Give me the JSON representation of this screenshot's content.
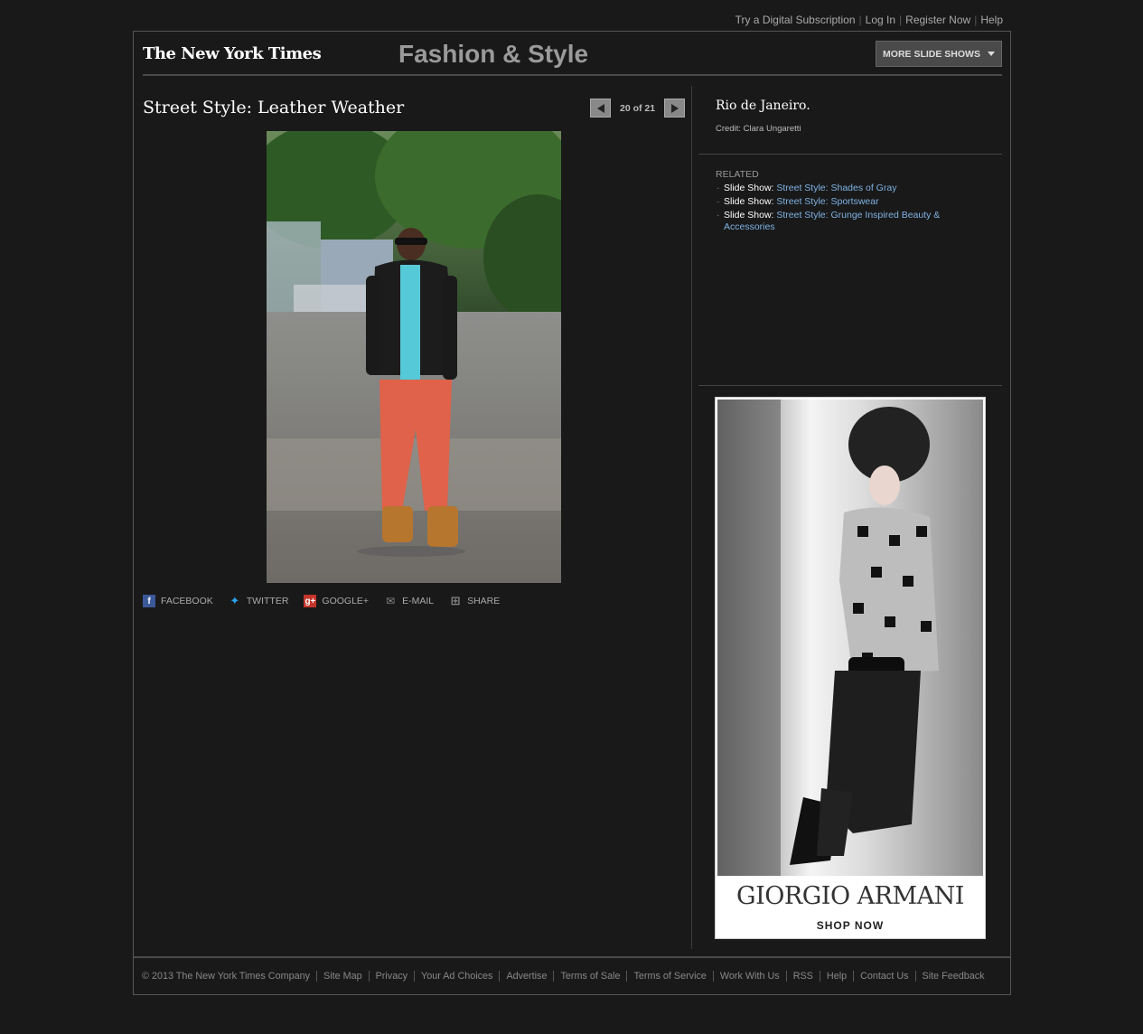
{
  "top_links": [
    "Try a Digital Subscription",
    "Log In",
    "Register Now",
    "Help"
  ],
  "masthead": {
    "logo": "The New York Times",
    "section": "Fashion & Style",
    "more_label": "MORE SLIDE SHOWS"
  },
  "slideshow": {
    "title": "Street Style: Leather Weather",
    "counter": "20 of 21"
  },
  "share": [
    {
      "label": "FACEBOOK",
      "icon": "facebook-icon"
    },
    {
      "label": "TWITTER",
      "icon": "twitter-icon"
    },
    {
      "label": "GOOGLE+",
      "icon": "google-plus-icon"
    },
    {
      "label": "E-MAIL",
      "icon": "email-icon"
    },
    {
      "label": "SHARE",
      "icon": "share-icon"
    }
  ],
  "caption": {
    "title": "Rio de Janeiro.",
    "credit": "Credit: Clara Ungaretti"
  },
  "related": {
    "heading": "RELATED",
    "items": [
      {
        "prefix": "Slide Show:",
        "link": "Street Style: Shades of Gray"
      },
      {
        "prefix": "Slide Show:",
        "link": "Street Style: Sportswear"
      },
      {
        "prefix": "Slide Show:",
        "link": "Street Style: Grunge Inspired Beauty & Accessories"
      }
    ]
  },
  "ad": {
    "brand": "GIORGIO ARMANI",
    "cta": "SHOP NOW"
  },
  "footer": [
    "© 2013 The New York Times Company",
    "Site Map",
    "Privacy",
    "Your Ad Choices",
    "Advertise",
    "Terms of Sale",
    "Terms of Service",
    "Work With Us",
    "RSS",
    "Help",
    "Contact Us",
    "Site Feedback"
  ],
  "colors": {
    "background": "#191919",
    "link": "#7fb2e3",
    "button": "#4a4a4a"
  }
}
